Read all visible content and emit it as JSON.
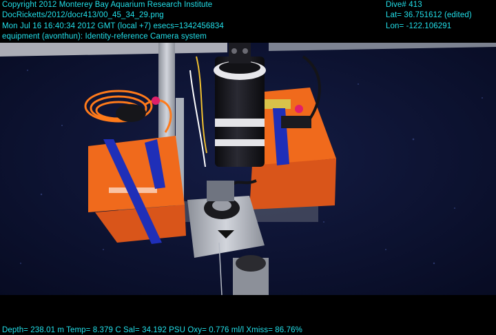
{
  "overlay": {
    "copyright": "Copyright 2012 Monterey Bay Aquarium Research Institute",
    "filename": "DocRicketts/2012/docr413/00_45_34_29.png",
    "datetime": "Mon Jul 16 16:40:34 2012 GMT (local +7)  esecs=1342456834",
    "equipment": "equipment (avonthun): Identity-reference Camera system",
    "dive": "Dive# 413",
    "latitude": "Lat= 36.751612 (edited)",
    "longitude": "Lon= -122.106291",
    "telemetry": "Depth= 238.01 m  Temp= 8.379 C  Sal= 34.192 PSU  Oxy= 0.776 ml/l  Xmiss= 86.76%"
  },
  "colors": {
    "overlay_text": "#22e0ea",
    "water": "#0c1230",
    "orange_box": "#f06a1c",
    "strap": "#1f2fb8",
    "metal": "#b9bcc4"
  },
  "icons": {
    "camera": "cylindrical-camera-housing"
  }
}
